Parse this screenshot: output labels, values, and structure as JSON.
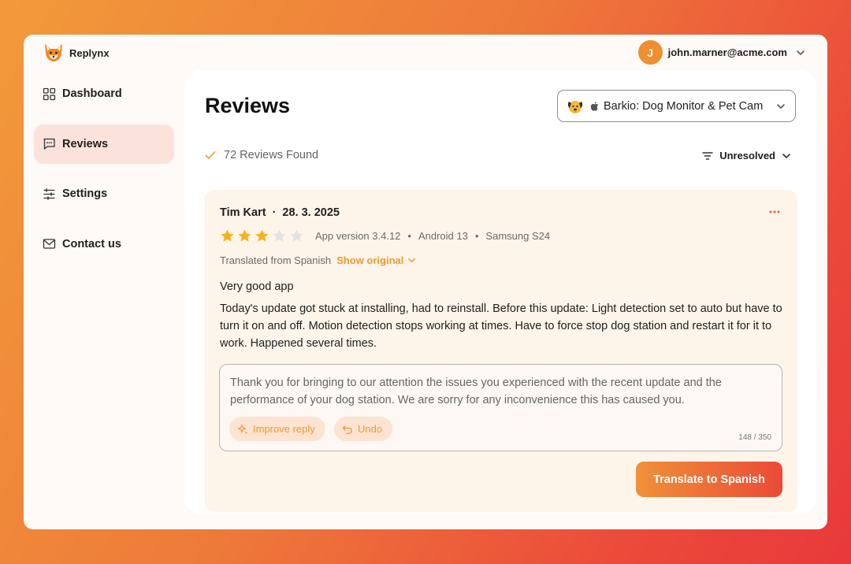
{
  "brand": {
    "name": "Replynx",
    "logo_icon": "fox-icon"
  },
  "user": {
    "initial": "J",
    "email": "john.marner@acme.com",
    "avatar_color": "#ef8f2f"
  },
  "sidebar": {
    "items": [
      {
        "label": "Dashboard",
        "icon": "grid-icon",
        "active": false
      },
      {
        "label": "Reviews",
        "icon": "message-icon",
        "active": true
      },
      {
        "label": "Settings",
        "icon": "sliders-icon",
        "active": false
      },
      {
        "label": "Contact us",
        "icon": "mail-icon",
        "active": false
      }
    ]
  },
  "main": {
    "title": "Reviews",
    "app_selector": {
      "app_name": "Barkio: Dog Monitor & Pet Cam",
      "platform_icon": "apple-icon"
    },
    "results": {
      "count_text": "72 Reviews Found"
    },
    "filter": {
      "label": "Unresolved"
    }
  },
  "review": {
    "author": "Tim Kart",
    "date": "28. 3. 2025",
    "rating": 3,
    "rating_max": 5,
    "app_version": "App version 3.4.12",
    "os": "Android 13",
    "device": "Samsung S24",
    "translated_label": "Translated from Spanish",
    "show_original_label": "Show original",
    "title": "Very good app",
    "body": "Today's update got stuck at installing, had to reinstall. Before this update: Light detection set to auto but have to turn it on and off. Motion detection stops working at times. Have to force stop dog station and restart it for it to work. Happened several times."
  },
  "reply": {
    "text": "Thank you for bringing to our attention the issues you experienced with the recent update and the performance of your dog station. We are sorry for any inconvenience this has caused you.",
    "improve_label": "Improve reply",
    "undo_label": "Undo",
    "counter": "148 / 350"
  },
  "actions": {
    "translate_label": "Translate to Spanish"
  },
  "colors": {
    "accent": "#ef9a2d",
    "active_nav_bg": "#fbe3dc",
    "card_bg": "#fdf4ea",
    "star": "#f5b21b"
  }
}
